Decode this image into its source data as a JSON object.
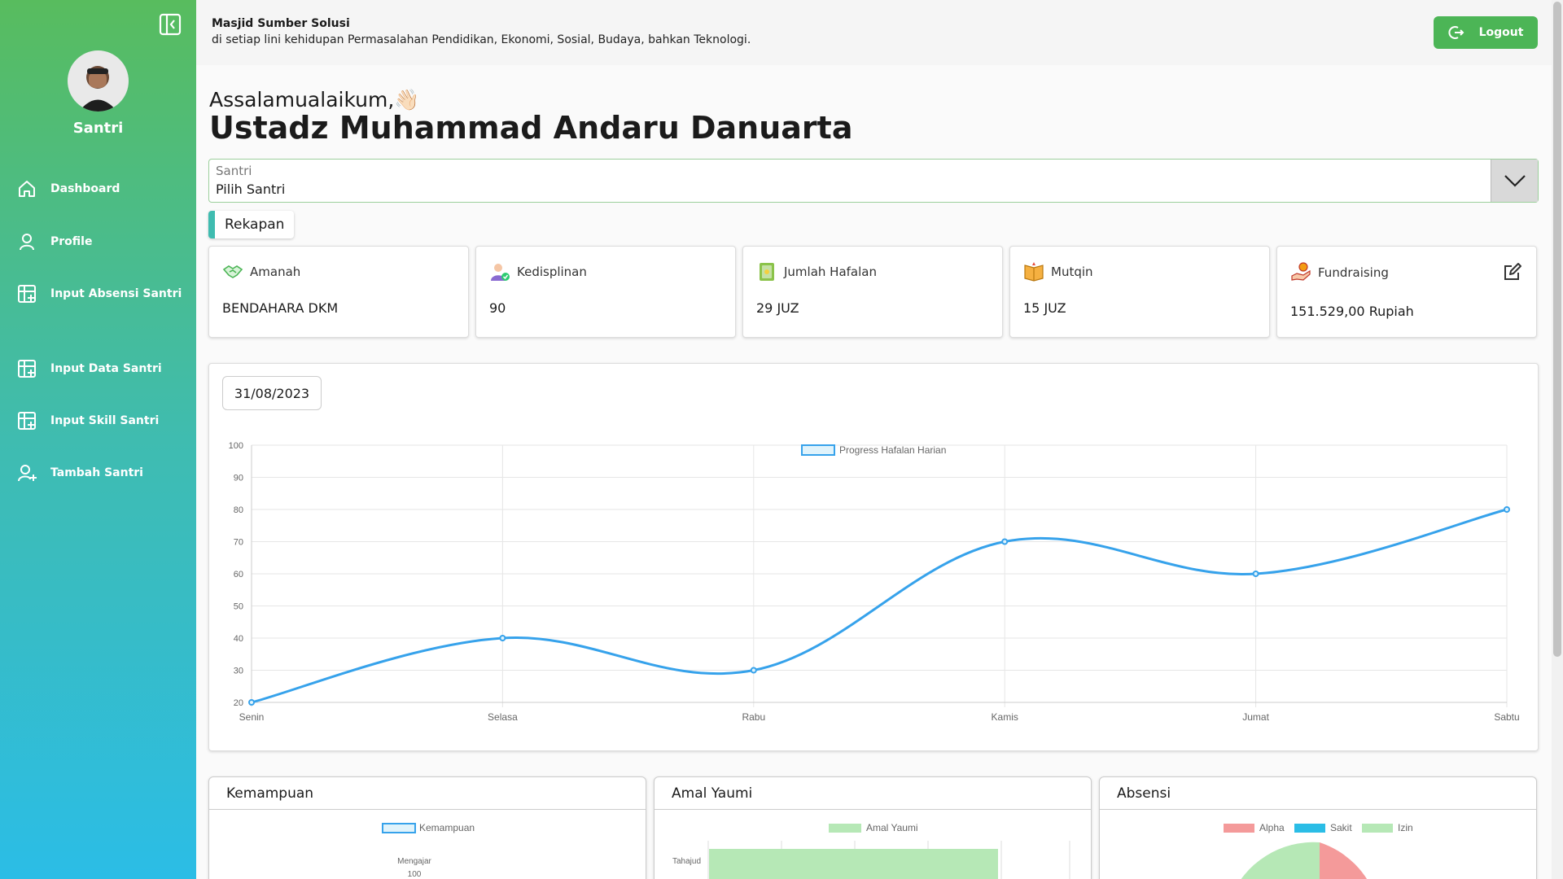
{
  "sidebar": {
    "role": "Santri",
    "items": [
      {
        "label": "Dashboard"
      },
      {
        "label": "Profile"
      },
      {
        "label": "Input Absensi Santri"
      },
      {
        "label": "Input Data Santri"
      },
      {
        "label": "Input Skill Santri"
      },
      {
        "label": "Tambah Santri"
      }
    ]
  },
  "header": {
    "org_name": "Masjid Sumber Solusi",
    "tagline": "di setiap lini kehidupan Permasalahan Pendidikan, Ekonomi, Sosial, Budaya, bahkan Teknologi.",
    "logout_label": "Logout"
  },
  "greeting": {
    "salutation": "Assalamualaikum,👋🏻",
    "name": "Ustadz Muhammad Andaru Danuarta"
  },
  "santri_select": {
    "label": "Santri",
    "value": "Pilih Santri"
  },
  "rekapan_label": "Rekapan",
  "cards": [
    {
      "title": "Amanah",
      "value": "BENDAHARA DKM"
    },
    {
      "title": "Kedisplinan",
      "value": "90"
    },
    {
      "title": "Jumlah Hafalan",
      "value": "29 JUZ"
    },
    {
      "title": "Mutqin",
      "value": "15 JUZ"
    },
    {
      "title": "Fundraising",
      "value": "151.529,00 Rupiah"
    }
  ],
  "date_value": "31/08/2023",
  "chart_data": {
    "type": "line",
    "categories": [
      "Senin",
      "Selasa",
      "Rabu",
      "Kamis",
      "Jumat",
      "Sabtu"
    ],
    "series": [
      {
        "name": "Progress Hafalan Harian",
        "values": [
          20,
          40,
          30,
          70,
          60,
          80
        ]
      }
    ],
    "ylim": [
      20,
      100
    ],
    "yticks": [
      100,
      90,
      80,
      70,
      60,
      50,
      40,
      30,
      20
    ],
    "grid": true,
    "legend": "top-center",
    "color": "#36a2eb"
  },
  "bottom_panels": [
    {
      "title": "Kemampuan",
      "legend": [
        "Kemampuan"
      ],
      "label": "Mengajar",
      "tick": "100"
    },
    {
      "title": "Amal Yaumi",
      "legend": [
        "Amal Yaumi"
      ],
      "label": "Tahajud"
    },
    {
      "title": "Absensi",
      "legend": [
        "Alpha",
        "Sakit",
        "Izin"
      ]
    }
  ],
  "colors": {
    "sidebar_top": "#58bc5e",
    "sidebar_bottom": "#2bbde6",
    "accent": "#4cb556",
    "alpha": "#f49a9a",
    "sakit": "#2bbde6",
    "izin": "#b6e8b6"
  }
}
